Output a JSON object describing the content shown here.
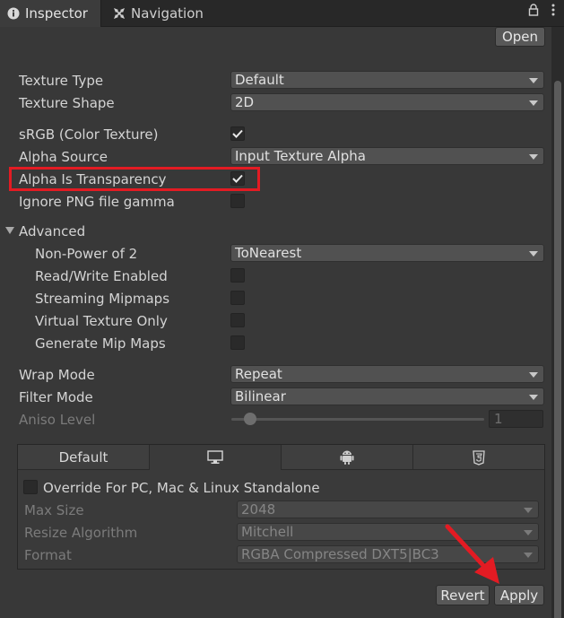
{
  "tabs": {
    "inspector_label": "Inspector",
    "navigation_label": "Navigation"
  },
  "toolbar": {
    "open_label": "Open"
  },
  "fields": {
    "texture_type": {
      "label": "Texture Type",
      "value": "Default"
    },
    "texture_shape": {
      "label": "Texture Shape",
      "value": "2D"
    },
    "srgb": {
      "label": "sRGB (Color Texture)",
      "checked": true
    },
    "alpha_source": {
      "label": "Alpha Source",
      "value": "Input Texture Alpha"
    },
    "alpha_is_transparency": {
      "label": "Alpha Is Transparency",
      "checked": true
    },
    "ignore_png_gamma": {
      "label": "Ignore PNG file gamma",
      "checked": false
    }
  },
  "advanced": {
    "label": "Advanced",
    "non_power_of_2": {
      "label": "Non-Power of 2",
      "value": "ToNearest"
    },
    "read_write": {
      "label": "Read/Write Enabled",
      "checked": false
    },
    "streaming_mipmaps": {
      "label": "Streaming Mipmaps",
      "checked": false
    },
    "virtual_texture_only": {
      "label": "Virtual Texture Only",
      "checked": false
    },
    "generate_mip_maps": {
      "label": "Generate Mip Maps",
      "checked": false
    }
  },
  "sampling": {
    "wrap_mode": {
      "label": "Wrap Mode",
      "value": "Repeat"
    },
    "filter_mode": {
      "label": "Filter Mode",
      "value": "Bilinear"
    },
    "aniso_level": {
      "label": "Aniso Level",
      "value": "1"
    }
  },
  "platform": {
    "tabs": [
      {
        "label": "Default",
        "icon": ""
      },
      {
        "label": "",
        "icon": "monitor-icon"
      },
      {
        "label": "",
        "icon": "android-icon"
      },
      {
        "label": "",
        "icon": "html5-icon"
      }
    ],
    "override_label": "Override For PC, Mac & Linux Standalone",
    "max_size": {
      "label": "Max Size",
      "value": "2048"
    },
    "resize_algorithm": {
      "label": "Resize Algorithm",
      "value": "Mitchell"
    },
    "format": {
      "label": "Format",
      "value": "RGBA Compressed DXT5|BC3"
    }
  },
  "actions": {
    "revert_label": "Revert",
    "apply_label": "Apply"
  },
  "colors": {
    "highlight": "#e31b23",
    "background": "#383838"
  }
}
